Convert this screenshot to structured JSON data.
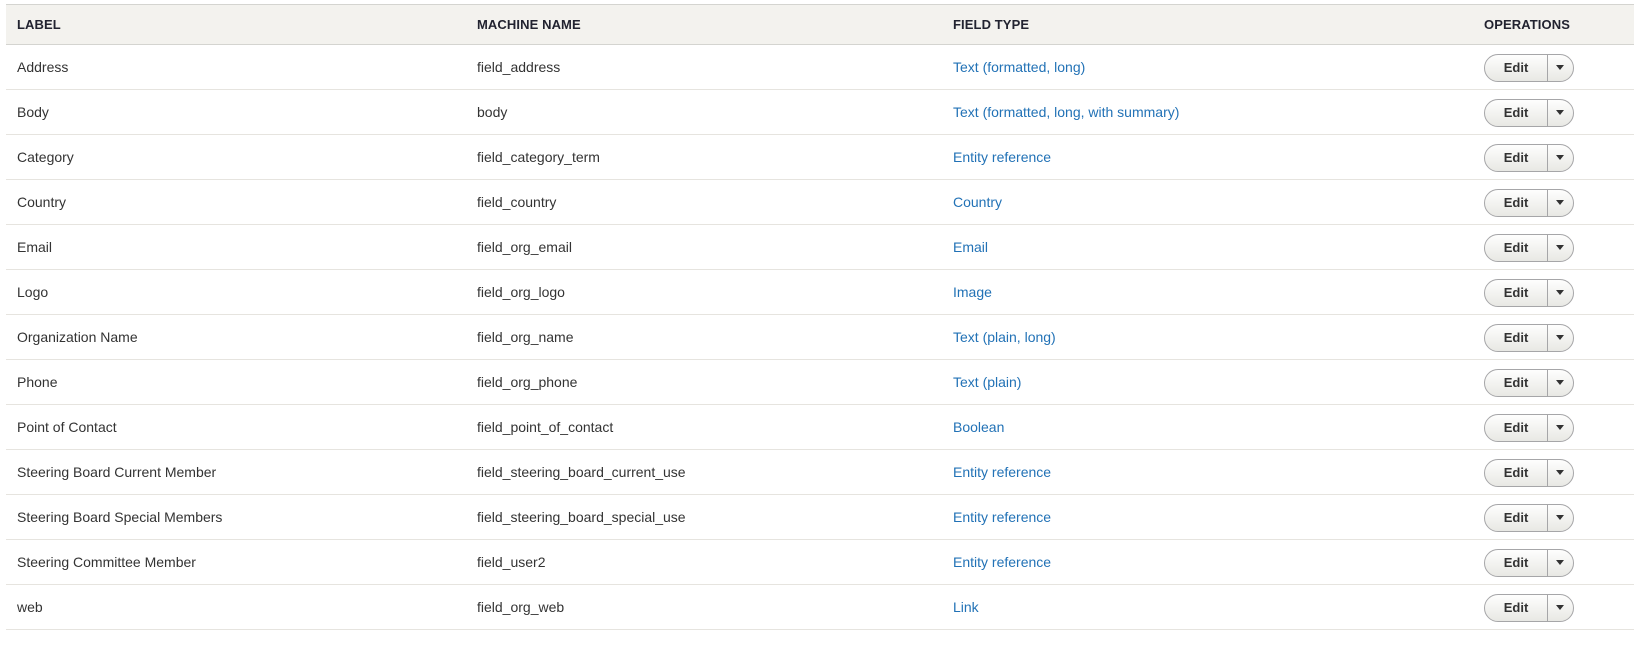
{
  "table": {
    "headers": {
      "label": "LABEL",
      "machine_name": "MACHINE NAME",
      "field_type": "FIELD TYPE",
      "operations": "OPERATIONS"
    },
    "edit_label": "Edit",
    "rows": [
      {
        "label": "Address",
        "machine": "field_address",
        "type": "Text (formatted, long)"
      },
      {
        "label": "Body",
        "machine": "body",
        "type": "Text (formatted, long, with summary)"
      },
      {
        "label": "Category",
        "machine": "field_category_term",
        "type": "Entity reference"
      },
      {
        "label": "Country",
        "machine": "field_country",
        "type": "Country"
      },
      {
        "label": "Email",
        "machine": "field_org_email",
        "type": "Email"
      },
      {
        "label": "Logo",
        "machine": "field_org_logo",
        "type": "Image"
      },
      {
        "label": "Organization Name",
        "machine": "field_org_name",
        "type": "Text (plain, long)"
      },
      {
        "label": "Phone",
        "machine": "field_org_phone",
        "type": "Text (plain)"
      },
      {
        "label": "Point of Contact",
        "machine": "field_point_of_contact",
        "type": "Boolean"
      },
      {
        "label": "Steering Board Current Member",
        "machine": "field_steering_board_current_use",
        "type": "Entity reference"
      },
      {
        "label": "Steering Board Special Members",
        "machine": "field_steering_board_special_use",
        "type": "Entity reference"
      },
      {
        "label": "Steering Committee Member",
        "machine": "field_user2",
        "type": "Entity reference"
      },
      {
        "label": "web",
        "machine": "field_org_web",
        "type": "Link"
      }
    ]
  }
}
